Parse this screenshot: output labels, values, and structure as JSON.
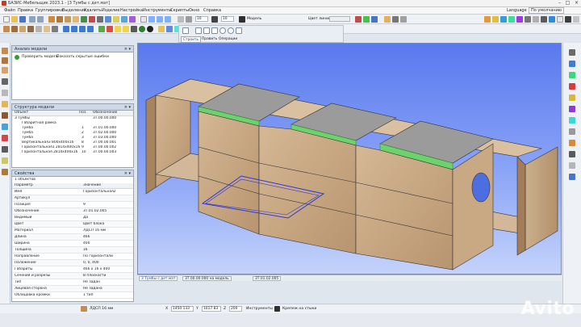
{
  "window": {
    "title": "БАЗИС-Мебельщик 2023.1 - [3 Тумбы с дет.мат]",
    "min_label": "–",
    "max_label": "□",
    "close_label": "×"
  },
  "menu": {
    "items": [
      "Файл",
      "Правка",
      "Группировка",
      "Выделение",
      "Удалить",
      "Изделие",
      "Настройка",
      "Инструменты",
      "Скрипты",
      "Окно",
      "Справка"
    ],
    "language": "Language",
    "language_value": "По умолчанию"
  },
  "toolbar": {
    "thickness_value": "10",
    "thickness2_value": "10",
    "line_color_label": "Цвет линии",
    "model_label": "Модель"
  },
  "mode_tabs": [
    "Строить",
    "Править",
    "Операции"
  ],
  "analysis_panel": {
    "title": "Анализ модели",
    "check_label": "Проверить модель",
    "show_errors_label": "Показать скрытые ошибки"
  },
  "structure_panel": {
    "title": "Структура модели",
    "columns": [
      "Объект",
      "Поз.",
      "Обозначение"
    ],
    "rows": [
      {
        "name": "3 Тумбы",
        "pos": "",
        "code": "3Т.00.00.000"
      },
      {
        "name": "Габаритная рамка",
        "pos": "",
        "code": ""
      },
      {
        "name": "Тумба",
        "pos": "1",
        "code": "3Т.01.00.000"
      },
      {
        "name": "Тумба",
        "pos": "2",
        "code": "3Т.02.00.000"
      },
      {
        "name": "Тумба",
        "pos": "3",
        "code": "3Т.03.00.000"
      },
      {
        "name": "Вертикальная3  800х400х16",
        "pos": "8",
        "code": "3Т.00.00.001"
      },
      {
        "name": "Горизонтальная1  2814х400х16",
        "pos": "9",
        "code": "3Т.00.00.002"
      },
      {
        "name": "Горизонтальная  2814х400х16",
        "pos": "10",
        "code": "3Т.00.00.003"
      }
    ]
  },
  "properties_panel": {
    "title": "Свойства",
    "count_label": "1 объектов",
    "columns": [
      "Параметр",
      "Значение"
    ],
    "rows": [
      {
        "name": "Имя",
        "value": "Горизонтальная2"
      },
      {
        "name": "Артикул",
        "value": ""
      },
      {
        "name": "Позиция",
        "value": "9"
      },
      {
        "name": "Обозначение",
        "value": "3Т.01.02.005"
      },
      {
        "name": "Видимый",
        "value": "Да"
      },
      {
        "name": "Цвет",
        "value": "Цвет блока"
      },
      {
        "name": "Материал",
        "value": "ЛДСП 16 мм"
      },
      {
        "name": "Длина",
        "value": "466"
      },
      {
        "name": "Ширина",
        "value": "400"
      },
      {
        "name": "Толщина",
        "value": "16"
      },
      {
        "name": "Направление",
        "value": "По горизонтали"
      },
      {
        "name": "Положение",
        "value": "0, 0, 400"
      },
      {
        "name": "Габариты",
        "value": "466 х 16 х 400"
      },
      {
        "name": "Сечения и разрезы",
        "value": "В плоскости"
      },
      {
        "name": "Тип",
        "value": "Не задан"
      },
      {
        "name": "Лицевая сторона",
        "value": "Не задана"
      },
      {
        "name": "Облицовка кромки",
        "value": "1 тип"
      }
    ]
  },
  "bottom_tabs": [
    "3 Тумбы с дет.мат",
    "3Т.00.00.000 на модель",
    "3Т.01.02.005"
  ],
  "status": {
    "material_label": "ЛДСП 16 мм",
    "x_label": "X",
    "x_value": "1450.133",
    "y_label": "Y",
    "y_value": "1017.83",
    "z_label": "Z",
    "z_value": "200",
    "tools_label": "Инструменты",
    "fastener_label": "Крепеж на стыки"
  },
  "watermark": "Avito",
  "colors": {
    "viewport_top": "#5a79ee",
    "wood": "#c9aa86",
    "top_panel": "#9a9a9a",
    "highlight_green": "#6bd66b",
    "selection_blue": "#2b38d8"
  }
}
